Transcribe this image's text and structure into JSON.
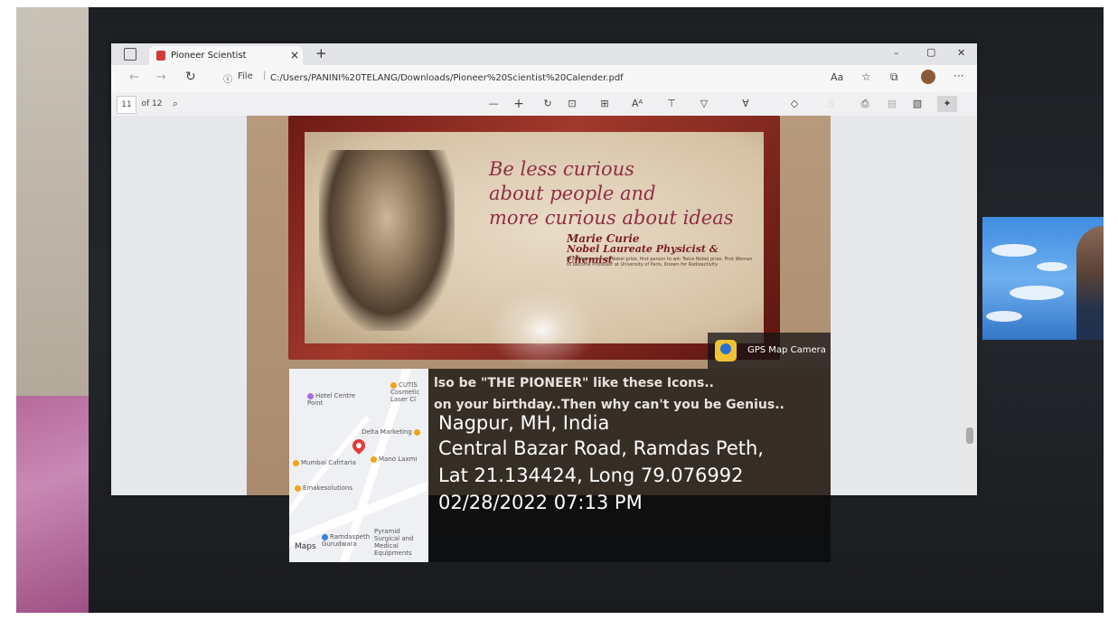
{
  "browser": {
    "tab_title": "Pioneer Scientist Calender.pdf",
    "tab_close": "×",
    "new_tab": "+",
    "url_prefix": "File",
    "url": "C:/Users/PANINI%20TELANG/Downloads/Pioneer%20Scientist%20Calender.pdf",
    "window_controls": {
      "minimize": "–",
      "maximize": "▢",
      "close": "✕"
    }
  },
  "pdf_toolbar": {
    "page_current": "11",
    "page_total": "of 12",
    "zoom_out": "—",
    "zoom_in": "+"
  },
  "pdf_page": {
    "quote_lines": [
      "Be less curious",
      "about people and",
      "more curious about ideas"
    ],
    "author": "Marie Curie",
    "author_title": "Nobel Laureate Physicist & Chemist",
    "author_desc": "First Woman to win Nobel prize, first person to win Twice Nobel prize, First Woman to become Professor at University of Paris, Known for Radioactivity",
    "line1": "lso be \"THE PIONEER\" like these Icons..",
    "line2": "on your birthday..Then why can't you be Genius.."
  },
  "gps": {
    "app_label": "GPS Map Camera",
    "place": "Nagpur, MH, India",
    "address": "Central Bazar Road, Ramdas Peth,",
    "coords": "Lat 21.134424, Long 79.076992",
    "datetime": "02/28/2022 07:13 PM"
  },
  "map": {
    "logo": "Maps",
    "pois": [
      "Hotel Centre Point",
      "CUTIS Cosmetic Laser Cl",
      "Delta Marketing",
      "Mumbai Cafrtaria",
      "Mano Laxmi",
      "Emakesolutions",
      "Ramdaspeth Gurudwara",
      "Pyramid Surgical and Medical Equipments"
    ]
  },
  "colors": {
    "quote": "#8e2e45",
    "frame": "#a1392c",
    "pin": "#e53935"
  }
}
